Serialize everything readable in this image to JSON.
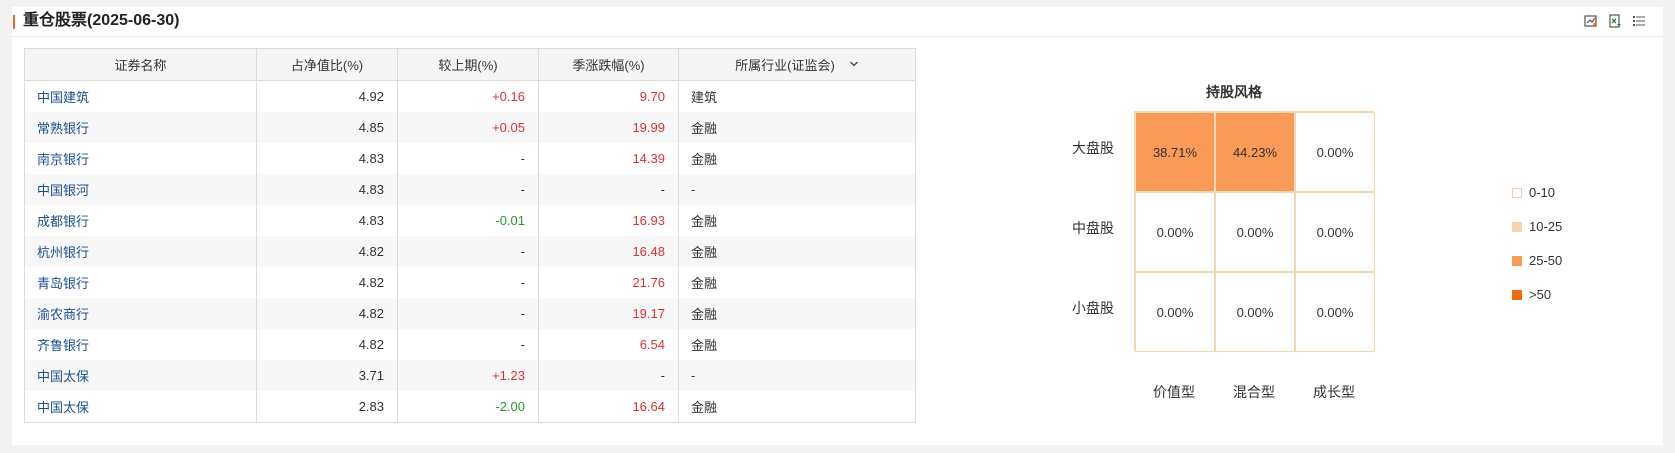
{
  "header": {
    "title": "重仓股票(2025-06-30)"
  },
  "table": {
    "columns": [
      "证券名称",
      "占净值比(%)",
      "较上期(%)",
      "季涨跌幅(%)",
      "所属行业(证监会)"
    ],
    "rows": [
      {
        "name": "中国建筑",
        "pct": "4.92",
        "chg": "+0.16",
        "chg_color": "red",
        "qtr": "9.70",
        "industry": "建筑"
      },
      {
        "name": "常熟银行",
        "pct": "4.85",
        "chg": "+0.05",
        "chg_color": "red",
        "qtr": "19.99",
        "industry": "金融"
      },
      {
        "name": "南京银行",
        "pct": "4.83",
        "chg": "-",
        "chg_color": "none",
        "qtr": "14.39",
        "industry": "金融"
      },
      {
        "name": "中国银河",
        "pct": "4.83",
        "chg": "-",
        "chg_color": "none",
        "qtr": "-",
        "industry": "-"
      },
      {
        "name": "成都银行",
        "pct": "4.83",
        "chg": "-0.01",
        "chg_color": "green",
        "qtr": "16.93",
        "industry": "金融"
      },
      {
        "name": "杭州银行",
        "pct": "4.82",
        "chg": "-",
        "chg_color": "none",
        "qtr": "16.48",
        "industry": "金融"
      },
      {
        "name": "青岛银行",
        "pct": "4.82",
        "chg": "-",
        "chg_color": "none",
        "qtr": "21.76",
        "industry": "金融"
      },
      {
        "name": "渝农商行",
        "pct": "4.82",
        "chg": "-",
        "chg_color": "none",
        "qtr": "19.17",
        "industry": "金融"
      },
      {
        "name": "齐鲁银行",
        "pct": "4.82",
        "chg": "-",
        "chg_color": "none",
        "qtr": "6.54",
        "industry": "金融"
      },
      {
        "name": "中国太保",
        "pct": "3.71",
        "chg": "+1.23",
        "chg_color": "red",
        "qtr": "-",
        "industry": "-"
      },
      {
        "name": "中国太保",
        "pct": "2.83",
        "chg": "-2.00",
        "chg_color": "green",
        "qtr": "16.64",
        "industry": "金融"
      }
    ]
  },
  "style_box": {
    "title": "持股风格",
    "row_labels": [
      "大盘股",
      "中盘股",
      "小盘股"
    ],
    "col_labels": [
      "价值型",
      "混合型",
      "成长型"
    ],
    "cells": [
      [
        "38.71%",
        "44.23%",
        "0.00%"
      ],
      [
        "0.00%",
        "0.00%",
        "0.00%"
      ],
      [
        "0.00%",
        "0.00%",
        "0.00%"
      ]
    ],
    "cell_colors": [
      [
        "#f99a58",
        "#f99a58",
        "#ffffff"
      ],
      [
        "#ffffff",
        "#ffffff",
        "#ffffff"
      ],
      [
        "#ffffff",
        "#ffffff",
        "#ffffff"
      ]
    ]
  },
  "legend": [
    {
      "label": "0-10",
      "color": "#ffffff",
      "border": "#f2c9a0"
    },
    {
      "label": "10-25",
      "color": "#fbd2ae",
      "border": "#fbd2ae"
    },
    {
      "label": "25-50",
      "color": "#f99a58",
      "border": "#f99a58"
    },
    {
      "label": ">50",
      "color": "#f26a10",
      "border": "#f26a10"
    }
  ],
  "colors": {
    "accent": "#e8672a",
    "up": "#e03030",
    "down": "#2a9a2a",
    "link": "#1a4f8f"
  }
}
